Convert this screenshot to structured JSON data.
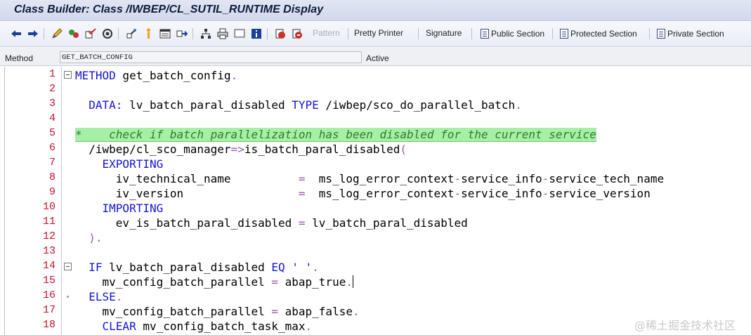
{
  "window": {
    "title": "Class Builder: Class /IWBEP/CL_SUTIL_RUNTIME Display"
  },
  "toolbar": {
    "icons": [
      "back-arrow-icon",
      "forward-arrow-icon",
      "edit-pencil-icon",
      "display-change-icon",
      "check-icon",
      "activate-icon",
      "test-icon",
      "where-used-icon",
      "object-list-icon",
      "navigation-icon",
      "hierarchy-icon",
      "print-icon",
      "screen-icon",
      "info-icon",
      "breakpoint-icon",
      "session-breakpoint-icon"
    ],
    "pattern_label": "Pattern",
    "pretty_printer_label": "Pretty Printer",
    "signature_label": "Signature",
    "public_section_label": "Public Section",
    "protected_section_label": "Protected Section",
    "private_section_label": "Private Section"
  },
  "statusbar": {
    "method_label": "Method",
    "method_value": "GET_BATCH_CONFIG",
    "state": "Active"
  },
  "editor": {
    "line_numbers": [
      "1",
      "2",
      "3",
      "4",
      "5",
      "6",
      "7",
      "8",
      "9",
      "10",
      "11",
      "12",
      "13",
      "14",
      "15",
      "16",
      "17",
      "18"
    ],
    "lines": [
      {
        "tokens": [
          {
            "t": "METHOD",
            "c": "kw"
          },
          {
            "t": " get_batch_config",
            "c": ""
          },
          {
            "t": ".",
            "c": "op"
          }
        ]
      },
      {
        "tokens": []
      },
      {
        "tokens": [
          {
            "t": "  DATA:",
            "c": "kw"
          },
          {
            "t": " lv_batch_paral_disabled ",
            "c": ""
          },
          {
            "t": "TYPE",
            "c": "kw"
          },
          {
            "t": " /iwbep/sco_do_parallel_batch",
            "c": ""
          },
          {
            "t": ".",
            "c": "op"
          }
        ]
      },
      {
        "tokens": []
      },
      {
        "tokens": [
          {
            "t": "*    check if batch parallelization has been disabled for the current service",
            "c": "comment"
          }
        ]
      },
      {
        "tokens": [
          {
            "t": "  /iwbep/cl_sco_manager",
            "c": ""
          },
          {
            "t": "=>",
            "c": "op"
          },
          {
            "t": "is_batch_paral_disabled",
            "c": ""
          },
          {
            "t": "(",
            "c": "op"
          }
        ]
      },
      {
        "tokens": [
          {
            "t": "    EXPORTING",
            "c": "kw"
          }
        ]
      },
      {
        "tokens": [
          {
            "t": "      iv_technical_name          ",
            "c": ""
          },
          {
            "t": "=",
            "c": "op"
          },
          {
            "t": "  ms_log_error_context",
            "c": ""
          },
          {
            "t": "-",
            "c": "op"
          },
          {
            "t": "service_info",
            "c": ""
          },
          {
            "t": "-",
            "c": "op"
          },
          {
            "t": "service_tech_name",
            "c": ""
          }
        ]
      },
      {
        "tokens": [
          {
            "t": "      iv_version                 ",
            "c": ""
          },
          {
            "t": "=",
            "c": "op"
          },
          {
            "t": "  ms_log_error_context",
            "c": ""
          },
          {
            "t": "-",
            "c": "op"
          },
          {
            "t": "service_info",
            "c": ""
          },
          {
            "t": "-",
            "c": "op"
          },
          {
            "t": "service_version",
            "c": ""
          }
        ]
      },
      {
        "tokens": [
          {
            "t": "    IMPORTING",
            "c": "kw"
          }
        ]
      },
      {
        "tokens": [
          {
            "t": "      ev_is_batch_paral_disabled ",
            "c": ""
          },
          {
            "t": "=",
            "c": "op"
          },
          {
            "t": " lv_batch_paral_disabled",
            "c": ""
          }
        ]
      },
      {
        "tokens": [
          {
            "t": "  )",
            "c": "op"
          },
          {
            "t": ".",
            "c": "op"
          }
        ]
      },
      {
        "tokens": []
      },
      {
        "tokens": [
          {
            "t": "  IF",
            "c": "kw"
          },
          {
            "t": " lv_batch_paral_disabled ",
            "c": ""
          },
          {
            "t": "EQ",
            "c": "kw"
          },
          {
            "t": " ",
            "c": ""
          },
          {
            "t": "' '",
            "c": "lit"
          },
          {
            "t": ".",
            "c": "op"
          }
        ]
      },
      {
        "tokens": [
          {
            "t": "    mv_config_batch_parallel ",
            "c": ""
          },
          {
            "t": "=",
            "c": "op"
          },
          {
            "t": " abap_true",
            "c": ""
          },
          {
            "t": ".",
            "c": "op"
          }
        ],
        "caret": true
      },
      {
        "tokens": [
          {
            "t": "  ELSE",
            "c": "kw"
          },
          {
            "t": ".",
            "c": "op"
          }
        ]
      },
      {
        "tokens": [
          {
            "t": "    mv_config_batch_parallel ",
            "c": ""
          },
          {
            "t": "=",
            "c": "op"
          },
          {
            "t": " abap_false",
            "c": ""
          },
          {
            "t": ".",
            "c": "op"
          }
        ]
      },
      {
        "tokens": [
          {
            "t": "    CLEAR",
            "c": "kw"
          },
          {
            "t": " mv_config_batch_task_max",
            "c": ""
          },
          {
            "t": ".",
            "c": "op"
          }
        ]
      }
    ]
  },
  "watermark": "@稀土掘金技术社区"
}
